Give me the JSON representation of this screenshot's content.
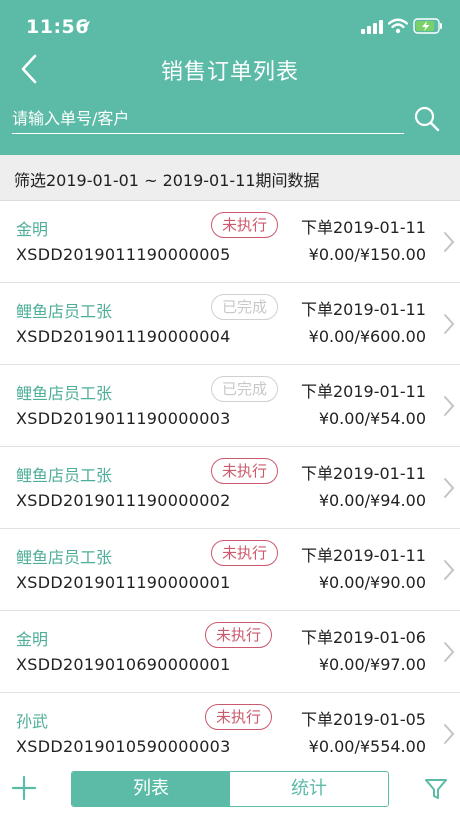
{
  "status_bar": {
    "time": "11:56"
  },
  "navbar": {
    "title": "销售订单列表"
  },
  "search": {
    "placeholder": "请输入单号/客户"
  },
  "filter": {
    "text": "筛选2019-01-01 ~ 2019-01-11期间数据"
  },
  "orders": [
    {
      "customer": "金明",
      "order_no": "XSDD2019011190000005",
      "status": "未执行",
      "date": "下单2019-01-11",
      "amount": "¥0.00/¥150.00"
    },
    {
      "customer": "鲤鱼店员工张",
      "order_no": "XSDD2019011190000004",
      "status": "已完成",
      "date": "下单2019-01-11",
      "amount": "¥0.00/¥600.00"
    },
    {
      "customer": "鲤鱼店员工张",
      "order_no": "XSDD2019011190000003",
      "status": "已完成",
      "date": "下单2019-01-11",
      "amount": "¥0.00/¥54.00"
    },
    {
      "customer": "鲤鱼店员工张",
      "order_no": "XSDD2019011190000002",
      "status": "未执行",
      "date": "下单2019-01-11",
      "amount": "¥0.00/¥94.00"
    },
    {
      "customer": "鲤鱼店员工张",
      "order_no": "XSDD2019011190000001",
      "status": "未执行",
      "date": "下单2019-01-11",
      "amount": "¥0.00/¥90.00"
    },
    {
      "customer": "金明",
      "order_no": "XSDD2019010690000001",
      "status": "未执行",
      "date": "下单2019-01-06",
      "amount": "¥0.00/¥97.00"
    },
    {
      "customer": "孙武",
      "order_no": "XSDD2019010590000003",
      "status": "未执行",
      "date": "下单2019-01-05",
      "amount": "¥0.00/¥554.00"
    }
  ],
  "bottom_bar": {
    "tab_list": "列表",
    "tab_stats": "统计"
  },
  "colors": {
    "theme": "#5bbba7",
    "pending": "#cc5a6e",
    "done": "#c8c8c8",
    "customer": "#4fae99"
  },
  "icons": [
    "location-arrow-icon",
    "signal-icon",
    "wifi-icon",
    "battery-charging-icon",
    "back-arrow-icon",
    "search-icon",
    "chevron-right-icon",
    "plus-icon",
    "funnel-filter-icon"
  ]
}
